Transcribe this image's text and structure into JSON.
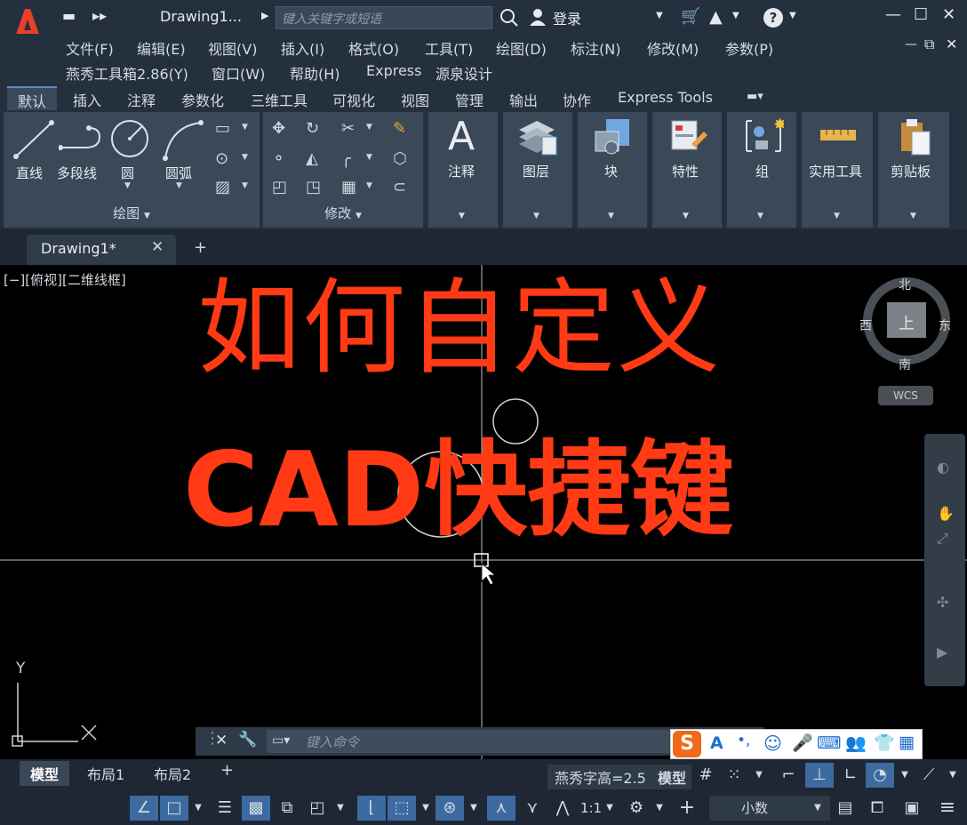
{
  "titlebar": {
    "doc_title": "Drawing1...",
    "search_placeholder": "键入关键字或短语",
    "login": "登录"
  },
  "menus": [
    "文件(F)",
    "编辑(E)",
    "视图(V)",
    "插入(I)",
    "格式(O)",
    "工具(T)",
    "绘图(D)",
    "标注(N)",
    "修改(M)",
    "参数(P)",
    "燕秀工具箱2.86(Y)",
    "窗口(W)",
    "帮助(H)",
    "Express",
    "源泉设计"
  ],
  "ribbon_tabs": [
    "默认",
    "插入",
    "注释",
    "参数化",
    "三维工具",
    "可视化",
    "视图",
    "管理",
    "输出",
    "协作",
    "Express Tools"
  ],
  "ribbon": {
    "draw_tools": [
      "直线",
      "多段线",
      "圆",
      "圆弧"
    ],
    "draw_panel_label": "绘图",
    "modify_panel_label": "修改",
    "big_tools": [
      "注释",
      "图层",
      "块",
      "特性",
      "组",
      "实用工具",
      "剪贴板"
    ]
  },
  "doc_tab": "Drawing1*",
  "canvas": {
    "viewport_label": "[−][俯视][二维线框]",
    "overlay_line1": "如何自定义",
    "overlay_line2": "CAD快捷键",
    "viewcube": {
      "north": "北",
      "south": "南",
      "east": "东",
      "west": "西",
      "top": "上",
      "wcs": "WCS"
    },
    "ucs_y": "Y"
  },
  "command": {
    "placeholder": "键入命令"
  },
  "layout_tabs": [
    "模型",
    "布局1",
    "布局2"
  ],
  "status": {
    "text_height": "燕秀字高=2.5",
    "model": "模型",
    "scale": "1:1",
    "units": "小数"
  },
  "colors": {
    "overlay": "#ff3a14",
    "accent": "#3d6aa0",
    "logo": "#e8412b"
  }
}
